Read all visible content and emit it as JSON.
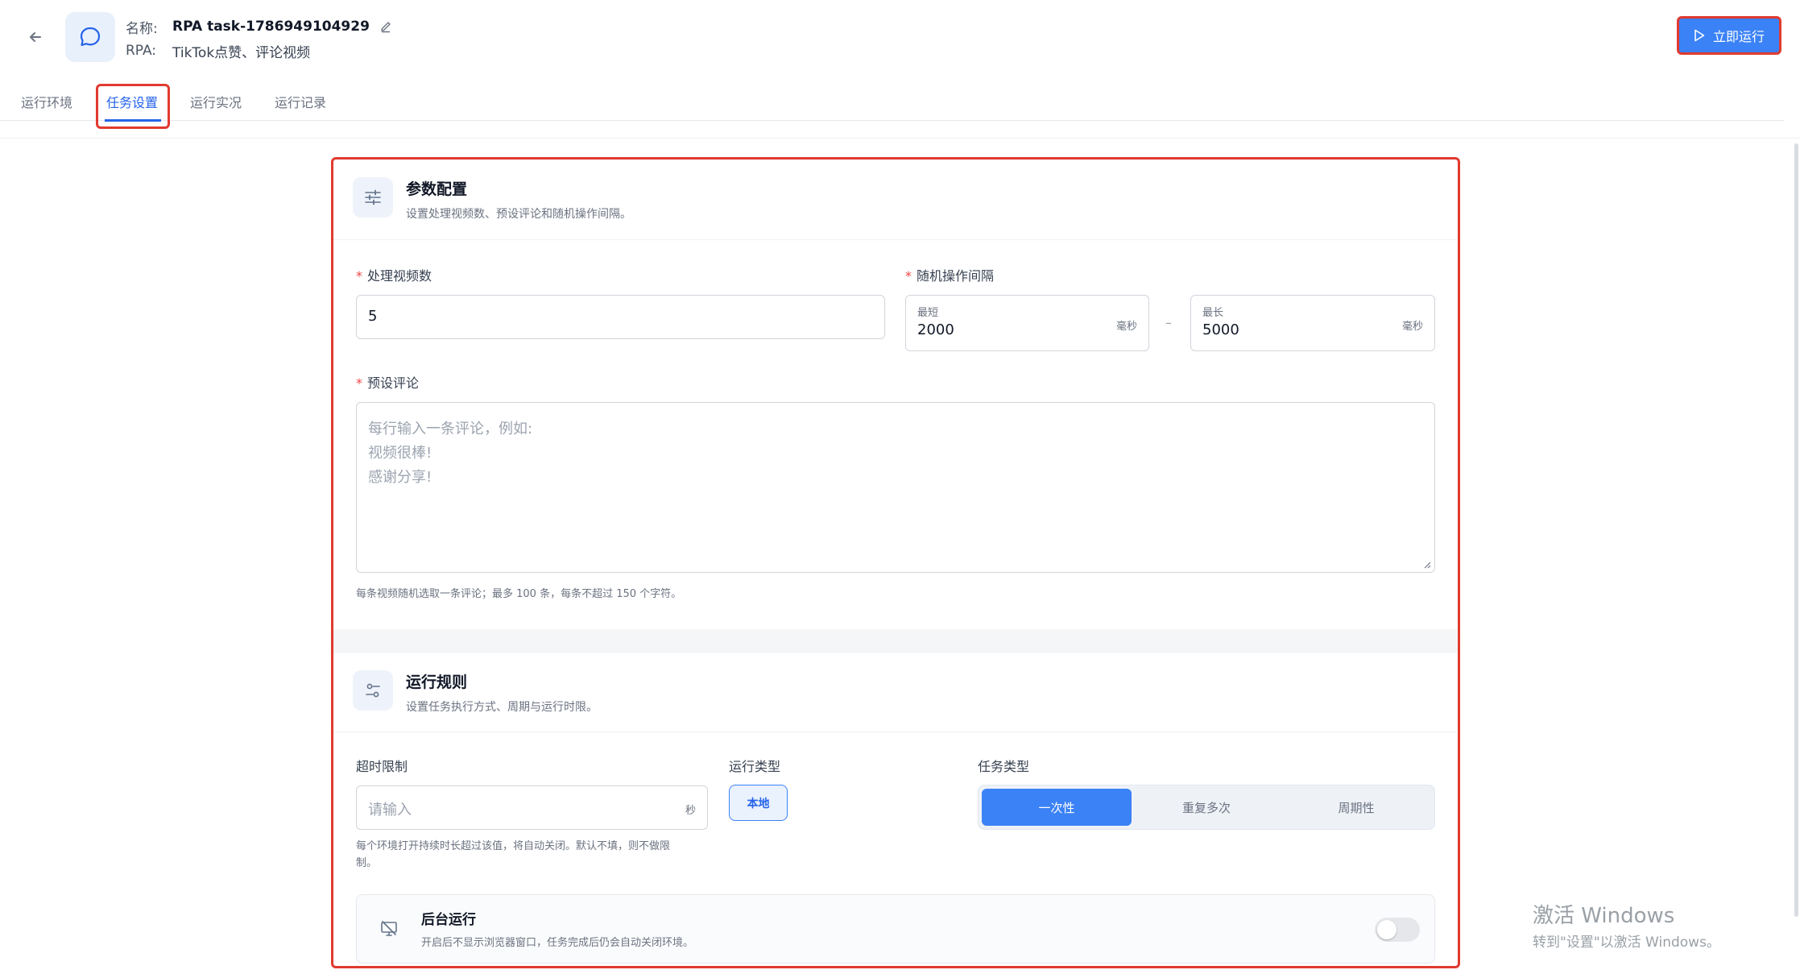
{
  "header": {
    "name_label": "名称:",
    "name_value": "RPA task-1786949104929",
    "rpa_label": "RPA:",
    "rpa_value": "TikTok点赞、评论视频",
    "run_button": "立即运行"
  },
  "tabs": [
    {
      "label": "运行环境"
    },
    {
      "label": "任务设置"
    },
    {
      "label": "运行实况"
    },
    {
      "label": "运行记录"
    }
  ],
  "params": {
    "title": "参数配置",
    "subtitle": "设置处理视频数、预设评论和随机操作间隔。",
    "video_count_label": "处理视频数",
    "video_count_value": "5",
    "interval_label": "随机操作间隔",
    "min_label": "最短",
    "min_value": "2000",
    "min_unit": "毫秒",
    "range_sep": "–",
    "max_label": "最长",
    "max_value": "5000",
    "max_unit": "毫秒",
    "comments_label": "预设评论",
    "comments_placeholder_lines": [
      "每行输入一条评论，例如:",
      "视频很棒!",
      "感谢分享!"
    ],
    "comments_hint": "每条视频随机选取一条评论；最多 100 条，每条不超过 150 个字符。"
  },
  "rules": {
    "title": "运行规则",
    "subtitle": "设置任务执行方式、周期与运行时限。",
    "timeout_label": "超时限制",
    "timeout_placeholder": "请输入",
    "timeout_unit": "秒",
    "timeout_hint_1": "每个环境打开持续时长超过该值，将自动关闭。默认不填，则不做限",
    "timeout_hint_2": "制。",
    "run_type_label": "运行类型",
    "run_type_value": "本地",
    "task_type_label": "任务类型",
    "task_type_options": [
      "一次性",
      "重复多次",
      "周期性"
    ],
    "background_title": "后台运行",
    "background_sub": "开启后不显示浏览器窗口，任务完成后仍会自动关闭环境。",
    "background_enabled": false
  },
  "watermark": {
    "line1": "激活 Windows",
    "line2": "转到\"设置\"以激活 Windows。"
  },
  "colors": {
    "accent": "#3b82f6",
    "highlight_border": "#e13a2f"
  }
}
